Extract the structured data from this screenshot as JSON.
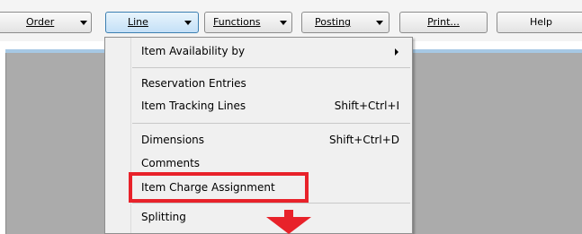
{
  "toolbar": {
    "buttons": [
      {
        "label": "Order"
      },
      {
        "label": "Line"
      },
      {
        "label": "Functions"
      },
      {
        "label": "Posting"
      },
      {
        "label": "Print..."
      },
      {
        "label": "Help"
      }
    ]
  },
  "menu": {
    "items": [
      {
        "label": "Item Availability by",
        "shortcut": ""
      },
      {
        "label": "Reservation Entries",
        "shortcut": ""
      },
      {
        "label": "Item Tracking Lines",
        "shortcut": "Shift+Ctrl+I"
      },
      {
        "label": "Dimensions",
        "shortcut": "Shift+Ctrl+D"
      },
      {
        "label": "Comments",
        "shortcut": ""
      },
      {
        "label": "Item Charge Assignment",
        "shortcut": ""
      },
      {
        "label": "Splitting",
        "shortcut": ""
      }
    ]
  },
  "colors": {
    "highlight": "#e8222a",
    "active_button": "#c4e0f7",
    "workspace": "#ababab",
    "divider": "#a6c8e4"
  }
}
